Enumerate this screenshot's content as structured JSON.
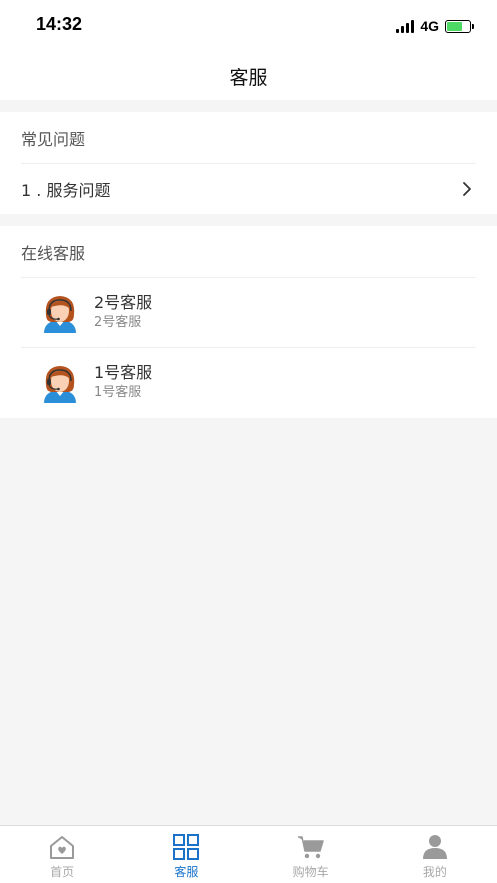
{
  "status": {
    "time": "14:32",
    "network": "4G"
  },
  "nav": {
    "title": "客服"
  },
  "faq": {
    "header": "常见问题",
    "items": [
      {
        "label": "1 . 服务问题"
      }
    ]
  },
  "online": {
    "header": "在线客服",
    "agents": [
      {
        "name": "2号客服",
        "subtitle": "2号客服"
      },
      {
        "name": "1号客服",
        "subtitle": "1号客服"
      }
    ]
  },
  "tabs": [
    {
      "label": "首页",
      "icon": "home-icon",
      "active": false
    },
    {
      "label": "客服",
      "icon": "grid-icon",
      "active": true
    },
    {
      "label": "购物车",
      "icon": "cart-icon",
      "active": false
    },
    {
      "label": "我的",
      "icon": "user-icon",
      "active": false
    }
  ],
  "colors": {
    "accent": "#1a73c9",
    "inactive": "#a8a8a8",
    "background": "#f5f5f5"
  }
}
